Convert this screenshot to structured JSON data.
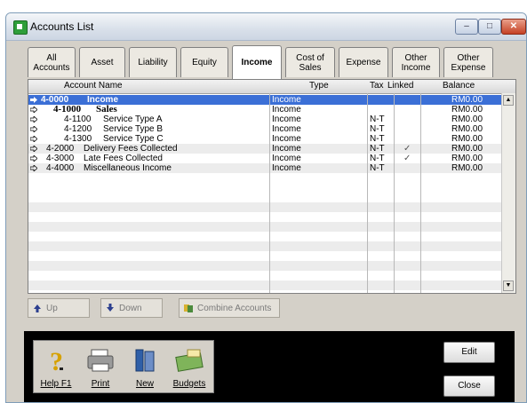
{
  "window": {
    "title": "Accounts List"
  },
  "title_buttons": {
    "minimize": "–",
    "maximize": "□",
    "close": "✕"
  },
  "tabs": [
    {
      "label": "All\nAccounts"
    },
    {
      "label": "Asset"
    },
    {
      "label": "Liability"
    },
    {
      "label": "Equity"
    },
    {
      "label": "Income",
      "active": true
    },
    {
      "label": "Cost of\nSales"
    },
    {
      "label": "Expense"
    },
    {
      "label": "Other\nIncome"
    },
    {
      "label": "Other\nExpense"
    }
  ],
  "columns": {
    "name": "Account Name",
    "type": "Type",
    "tax": "Tax",
    "linked": "Linked",
    "balance": "Balance"
  },
  "rows": [
    {
      "number": "4-0000",
      "name": "Income",
      "type": "Income",
      "tax": "",
      "linked": "",
      "balance": "RM0.00"
    },
    {
      "number": "4-1000",
      "name": "Sales",
      "type": "Income",
      "tax": "",
      "linked": "",
      "balance": "RM0.00"
    },
    {
      "number": "4-1100",
      "name": "Service Type A",
      "type": "Income",
      "tax": "N-T",
      "linked": "",
      "balance": "RM0.00"
    },
    {
      "number": "4-1200",
      "name": "Service Type B",
      "type": "Income",
      "tax": "N-T",
      "linked": "",
      "balance": "RM0.00"
    },
    {
      "number": "4-1300",
      "name": "Service Type C",
      "type": "Income",
      "tax": "N-T",
      "linked": "",
      "balance": "RM0.00"
    },
    {
      "number": "4-2000",
      "name": "Delivery Fees Collected",
      "type": "Income",
      "tax": "N-T",
      "linked": "✓",
      "balance": "RM0.00"
    },
    {
      "number": "4-3000",
      "name": "Late Fees Collected",
      "type": "Income",
      "tax": "N-T",
      "linked": "✓",
      "balance": "RM0.00"
    },
    {
      "number": "4-4000",
      "name": "Miscellaneous Income",
      "type": "Income",
      "tax": "N-T",
      "linked": "",
      "balance": "RM0.00"
    }
  ],
  "actions": {
    "up": "Up",
    "down": "Down",
    "combine": "Combine Accounts"
  },
  "toolbar": {
    "help": "Help F1",
    "print": "Print",
    "new": "New",
    "budgets": "Budgets"
  },
  "dialog_buttons": {
    "edit": "Edit",
    "close": "Close"
  },
  "colors": {
    "selection": "#3b6fd6",
    "window_bg": "#d4d0c8"
  }
}
